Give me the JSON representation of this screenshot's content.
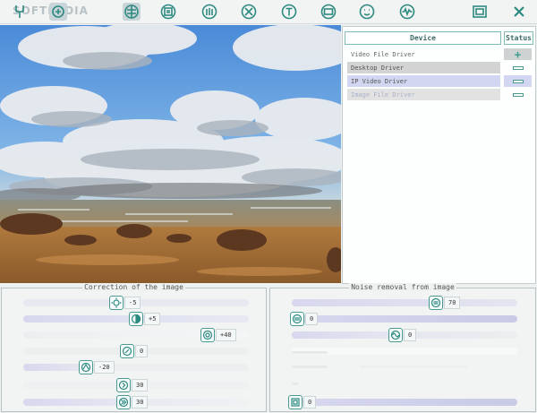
{
  "toolbar": {
    "watermark": "SOFTPEDIA",
    "icons": [
      "tuning-fork-icon",
      "filter-icon",
      "globe-icon",
      "film-icon",
      "microphone-icon",
      "tools-icon",
      "text-icon",
      "screen-icon",
      "face-icon",
      "waveform-icon",
      "window-icon",
      "close-icon"
    ]
  },
  "device_panel": {
    "header_device": "Device",
    "header_status": "Status",
    "rows": [
      {
        "label": "Video File Driver",
        "status": "plus"
      },
      {
        "label": "Desktop Driver",
        "status": "bar"
      },
      {
        "label": "IP Video Driver",
        "status": "bar"
      },
      {
        "label": "Image File Driver",
        "status": "bar"
      }
    ]
  },
  "correction": {
    "title": "Correction of the image",
    "sliders": [
      {
        "icon": "brightness-icon",
        "value": "-5"
      },
      {
        "icon": "contrast-icon",
        "value": "+5"
      },
      {
        "icon": "saturation-icon",
        "value": "+40"
      },
      {
        "icon": "hue-icon",
        "value": "0"
      },
      {
        "icon": "gamma-icon",
        "value": "-20"
      },
      {
        "icon": "sharpness-icon",
        "value": "30"
      },
      {
        "icon": "sharpen-more-icon",
        "value": "30"
      }
    ]
  },
  "noise": {
    "title": "Noise removal from image",
    "sliders": [
      {
        "icon": "denoise-icon",
        "value": "70"
      },
      {
        "icon": "spatial-filter-icon",
        "value": "0"
      },
      {
        "icon": "temporal-filter-icon",
        "value": "0"
      },
      {
        "icon": "bottom-filter-icon",
        "value": "0"
      }
    ]
  },
  "colors": {
    "accent": "#3aa090",
    "track": "#d7d8ee",
    "row_selected": "#d3d6f0"
  }
}
